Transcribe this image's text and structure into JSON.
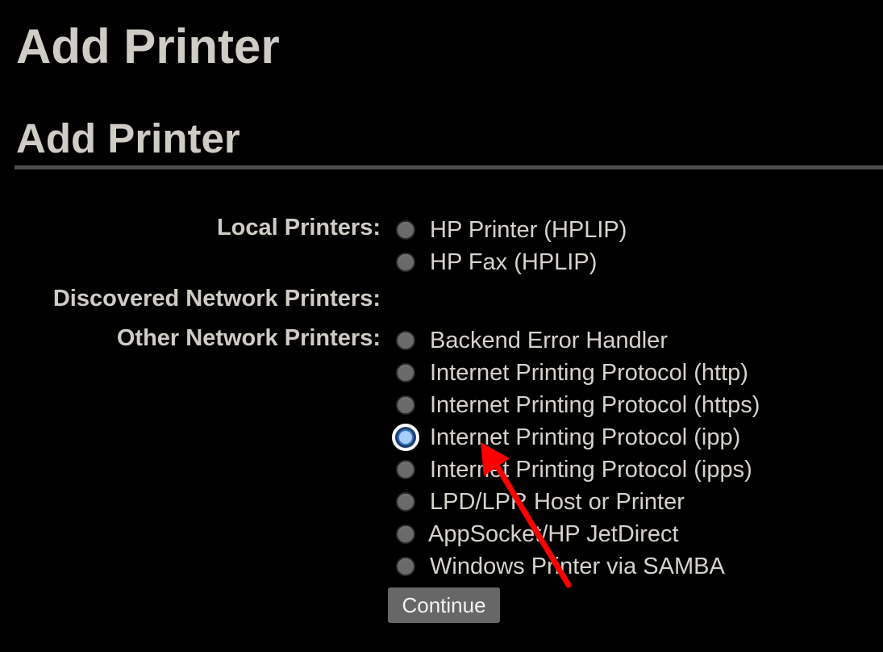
{
  "page": {
    "title": "Add Printer"
  },
  "section": {
    "title": "Add Printer"
  },
  "groups": {
    "local": {
      "label": "Local Printers:",
      "options": [
        {
          "label": "HP Printer (HPLIP)",
          "selected": false
        },
        {
          "label": "HP Fax (HPLIP)",
          "selected": false
        }
      ]
    },
    "discovered": {
      "label": "Discovered Network Printers:",
      "options": []
    },
    "other": {
      "label": "Other Network Printers:",
      "options": [
        {
          "label": "Backend Error Handler",
          "selected": false
        },
        {
          "label": "Internet Printing Protocol (http)",
          "selected": false
        },
        {
          "label": "Internet Printing Protocol (https)",
          "selected": false
        },
        {
          "label": "Internet Printing Protocol (ipp)",
          "selected": true
        },
        {
          "label": "Internet Printing Protocol (ipps)",
          "selected": false
        },
        {
          "label": "LPD/LPR Host or Printer",
          "selected": false
        },
        {
          "label": "AppSocket/HP JetDirect",
          "selected": false
        },
        {
          "label": "Windows Printer via SAMBA",
          "selected": false
        }
      ]
    }
  },
  "actions": {
    "continue_label": "Continue"
  },
  "colors": {
    "background": "#000000",
    "text": "#d6d2cc",
    "rule": "#4d4d4b",
    "button": "#676767",
    "annotation_arrow": "#ff0000",
    "radio_selected": "#a9cdfa"
  },
  "annotation": {
    "icon": "red-arrow-icon",
    "points_to": "Internet Printing Protocol (ipp)"
  }
}
